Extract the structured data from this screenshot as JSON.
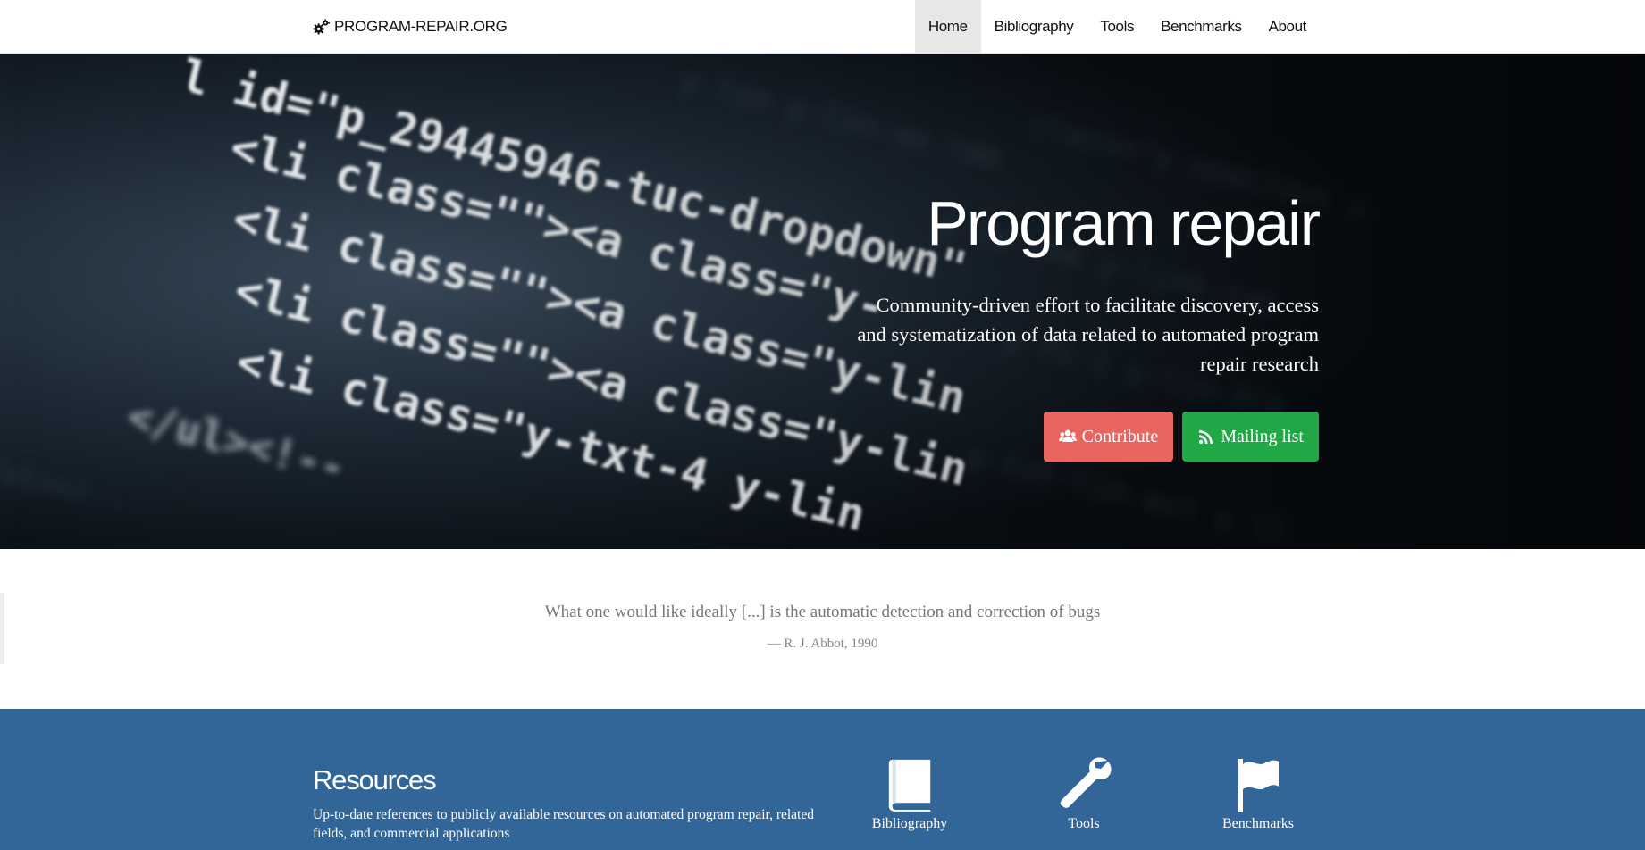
{
  "navbar": {
    "brand": "PROGRAM-REPAIR.ORG",
    "brand_icon": "gears-icon",
    "items": [
      {
        "label": "Home",
        "active": true
      },
      {
        "label": "Bibliography",
        "active": false
      },
      {
        "label": "Tools",
        "active": false
      },
      {
        "label": "Benchmarks",
        "active": false
      },
      {
        "label": "About",
        "active": false
      }
    ]
  },
  "hero": {
    "title": "Program repair",
    "subtitle": "Community-driven effort to facilitate discovery, access and systematization of data related to automated program repair research",
    "buttons": {
      "contribute": {
        "label": "Contribute",
        "icon": "users-icon",
        "color": "#e9655f"
      },
      "mailing": {
        "label": "Mailing list",
        "icon": "rss-icon",
        "color": "#21a847"
      }
    },
    "code_lines": [
      "l id=\"p_29445946-tuc-dropdown\"",
      "<li class=\"\"><a class=\"y-",
      "<li class=\"\"><a class=\"y-lin",
      "<li class=\"\"><a class=\"y-lin",
      "<li class=\"y-txt-4 y-lin",
      "</ul><!--"
    ]
  },
  "quote": {
    "text": "What one would like ideally [...] is the automatic detection and correction of bugs",
    "author": "— R. J. Abbot, 1990"
  },
  "resources": {
    "title": "Resources",
    "description": "Up-to-date references to publicly available resources on automated program repair, related fields, and commercial applications",
    "links": [
      {
        "label": "Bibliography",
        "icon": "book-icon"
      },
      {
        "label": "Tools",
        "icon": "wrench-icon"
      },
      {
        "label": "Benchmarks",
        "icon": "flag-icon"
      }
    ],
    "color": "#326699"
  }
}
